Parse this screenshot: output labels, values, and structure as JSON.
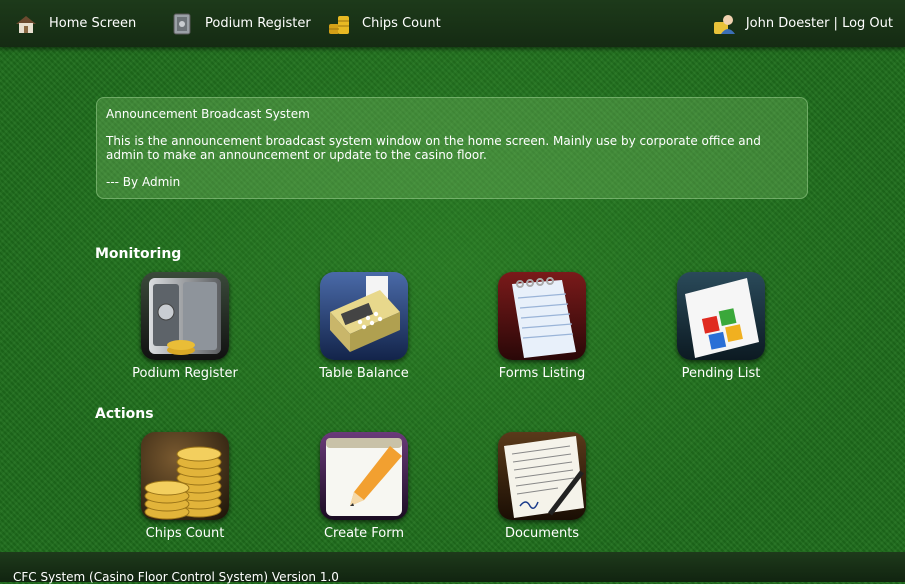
{
  "nav": {
    "home_label": "Home Screen",
    "podium_label": "Podium Register",
    "chips_label": "Chips Count"
  },
  "user": {
    "name": "John Doester",
    "separator": " | ",
    "logout_label": "Log Out"
  },
  "announcement": {
    "title": "Announcement Broadcast System",
    "body": "This is the announcement broadcast system window on the home screen. Mainly use by corporate office and admin to make an announcement or update to the casino floor.",
    "signature": "--- By Admin"
  },
  "sections": {
    "monitoring": "Monitoring",
    "actions": "Actions"
  },
  "monitoring_tiles": [
    {
      "label": "Podium Register",
      "icon": "safe-icon"
    },
    {
      "label": "Table Balance",
      "icon": "cash-register-icon"
    },
    {
      "label": "Forms Listing",
      "icon": "notepad-icon"
    },
    {
      "label": "Pending List",
      "icon": "windows-logo-icon"
    }
  ],
  "action_tiles": [
    {
      "label": "Chips Count",
      "icon": "coin-stacks-icon"
    },
    {
      "label": "Create Form",
      "icon": "pencil-notepad-icon"
    },
    {
      "label": "Documents",
      "icon": "signed-document-icon"
    }
  ],
  "footer": {
    "text": "CFC System (Casino Floor Control System) Version 1.0"
  }
}
